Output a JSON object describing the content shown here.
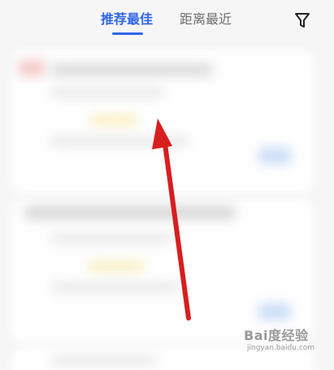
{
  "tabs": {
    "recommended_label": "推荐最佳",
    "nearest_label": "距离最近"
  },
  "filter": {
    "icon": "filter-icon"
  },
  "colors": {
    "active_tab": "#2f66e8",
    "inactive_tab": "#6d6d6d",
    "annotation_arrow": "#d81e1e"
  },
  "watermark": {
    "line1": "Bai度经验",
    "line2": "jingyan.baidu.com"
  }
}
